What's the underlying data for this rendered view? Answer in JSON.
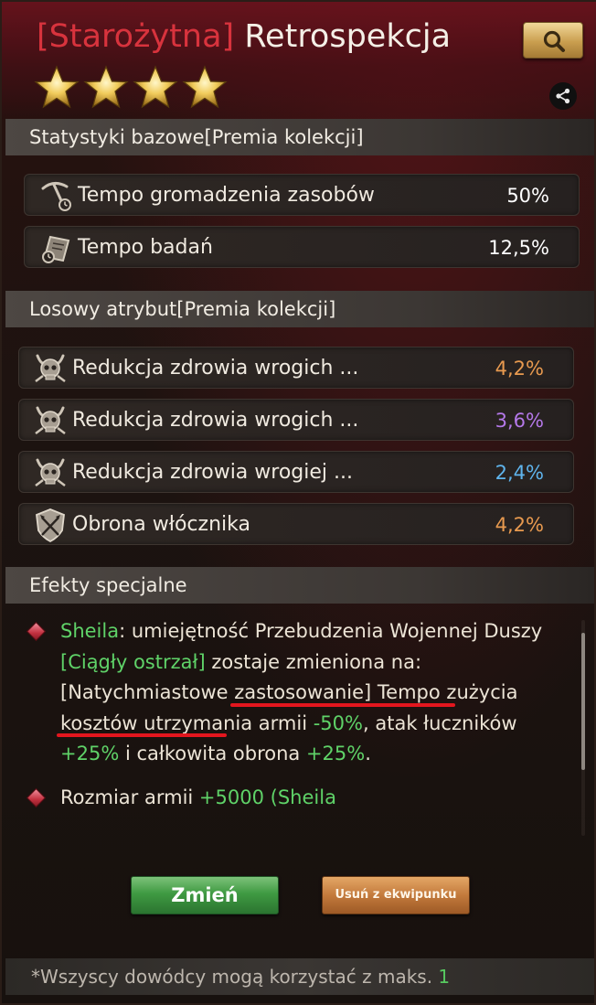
{
  "header": {
    "rarity": "[Starożytna]",
    "name": "Retrospekcja",
    "stars": 4
  },
  "sections": {
    "base": "Statystyki bazowe[Premia kolekcji]",
    "random": "Losowy atrybut[Premia kolekcji]",
    "special": "Efekty specjalne"
  },
  "base_stats": [
    {
      "label": "Tempo gromadzenia zasobów",
      "value": "50%",
      "icon": "pickaxe-clock-icon"
    },
    {
      "label": "Tempo badań",
      "value": "12,5%",
      "icon": "research-scroll-icon"
    }
  ],
  "random_attrs": [
    {
      "label": "Redukcja zdrowia wrogich ...",
      "value": "4,2%",
      "color": "#e89a4f",
      "icon": "horned-skull-icon"
    },
    {
      "label": "Redukcja zdrowia wrogich ...",
      "value": "3,6%",
      "color": "#b478e8",
      "icon": "horned-skull-icon"
    },
    {
      "label": "Redukcja zdrowia wrogiej ...",
      "value": "2,4%",
      "color": "#5fb4ec",
      "icon": "horned-skull-icon"
    },
    {
      "label": "Obrona włócznika",
      "value": "4,2%",
      "color": "#e89a4f",
      "icon": "spear-shield-icon"
    }
  ],
  "effects": {
    "e1": {
      "hero": "Sheila",
      "t1": ": umiejętność Przebudzenia Wojennej Duszy ",
      "skill": "[Ciągły ostrzał]",
      "t2": " zostaje ",
      "t3": "zmieniona na:[Natychmiastowe zastosowanie]",
      "t4": " Tempo zużycia kosztów utrzymania armii ",
      "v1": "-50%",
      "t5": ", atak łuczników ",
      "v2": "+25%",
      "t6": " i całkowita obrona ",
      "v3": "+25%",
      "t7": "."
    },
    "e2": {
      "t1": "Rozmiar armii ",
      "v1": "+5000",
      "t2": " (Sheila"
    }
  },
  "buttons": {
    "change": "Zmień",
    "remove": "Usuń z ekwipunku"
  },
  "footer": {
    "text": "*Wszyscy dowódcy mogą korzystać z maks. ",
    "count": "1"
  },
  "colors": {
    "rarity": "#d8333d",
    "green": "#5fd268",
    "underline": "#e3161e"
  }
}
